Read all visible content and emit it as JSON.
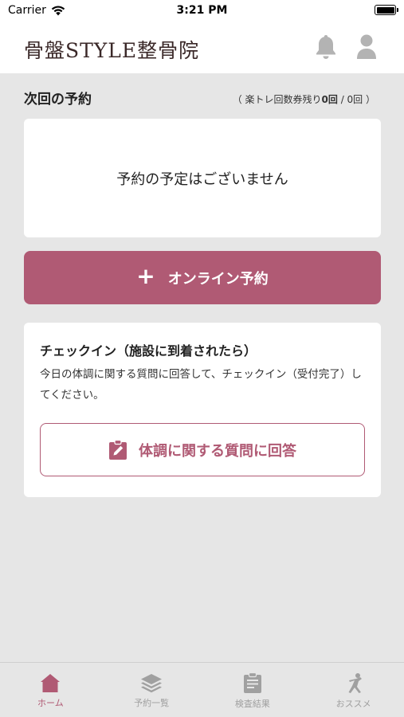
{
  "status_bar": {
    "carrier": "Carrier",
    "time": "3:21 PM"
  },
  "header": {
    "brand": "骨盤STYLE整骨院"
  },
  "next_reservation": {
    "title": "次回の予約",
    "tickets_prefix": "（ 楽トレ回数券残り",
    "tickets_remaining": "0回",
    "tickets_suffix": " / 0回 ）",
    "empty_message": "予約の予定はございません"
  },
  "online_reservation": {
    "label": "オンライン予約"
  },
  "checkin": {
    "title": "チェックイン（施設に到着されたら）",
    "description": "今日の体調に関する質問に回答して、チェックイン（受付完了）してください。",
    "answer_label": "体調に関する質問に回答"
  },
  "tabbar": {
    "items": [
      {
        "label": "ホーム",
        "icon": "home-icon",
        "active": true
      },
      {
        "label": "予約一覧",
        "icon": "layers-icon",
        "active": false
      },
      {
        "label": "検査結果",
        "icon": "clipboard-icon",
        "active": false
      },
      {
        "label": "おススメ",
        "icon": "stretch-icon",
        "active": false
      }
    ]
  },
  "colors": {
    "accent": "#b05a74",
    "background": "#e6e6e6",
    "inactive_tab": "#a0a0a0",
    "header_icon": "#b3b3b3"
  }
}
